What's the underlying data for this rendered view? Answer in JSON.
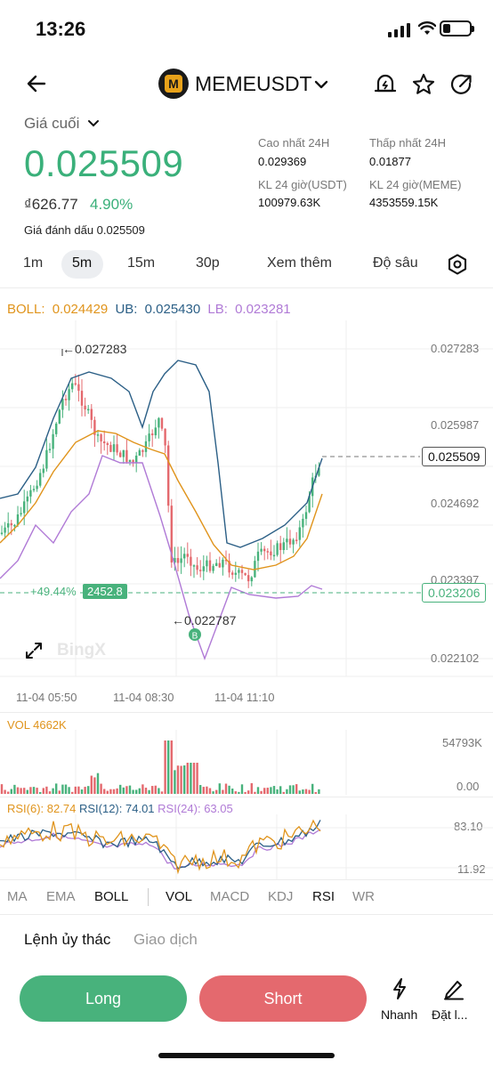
{
  "status_bar": {
    "time": "13:26"
  },
  "header": {
    "pair": "MEMEUSDT",
    "logo_letter": "M"
  },
  "price": {
    "label": "Giá cuối",
    "last": "0.025509",
    "fiat": "₫626.77",
    "change_pct": "4.90%",
    "mark": "Giá đánh dấu 0.025509"
  },
  "stats": {
    "high_label": "Cao nhất 24H",
    "high": "0.029369",
    "low_label": "Thấp nhất 24H",
    "low": "0.01877",
    "vol_usdt_label": "KL 24 giờ(USDT)",
    "vol_usdt": "100979.63K",
    "vol_meme_label": "KL 24 giờ(MEME)",
    "vol_meme": "4353559.15K"
  },
  "timeframes": {
    "t1": "1m",
    "t2": "5m",
    "t3": "15m",
    "t4": "30p",
    "more": "Xem thêm",
    "depth": "Độ sâu",
    "active": "5m"
  },
  "boll": {
    "label": "BOLL:",
    "mid": "0.024429",
    "ub_label": "UB:",
    "ub": "0.025430",
    "lb_label": "LB:",
    "lb": "0.023281"
  },
  "price_axis": {
    "p1": "0.027283",
    "p2": "0.025987",
    "p3": "0.024692",
    "p4": "0.023397",
    "p5": "0.022102"
  },
  "chart_tags": {
    "high_marker": "←0.027283",
    "low_marker": "←0.022787",
    "current": "0.025509",
    "position_pct": "+49.44%",
    "position_qty": "2452.8",
    "position_price": "0.023206",
    "buy_marker": "B",
    "watermark": "BingX"
  },
  "time_axis": {
    "t1": "11-04 05:50",
    "t2": "11-04 08:30",
    "t3": "11-04 11:10"
  },
  "volume": {
    "legend": "VOL 4662K",
    "max": "54793K",
    "min": "0.00"
  },
  "rsi": {
    "l6": "RSI(6):",
    "v6": "82.74",
    "l12": "RSI(12):",
    "v12": "74.01",
    "l24": "RSI(24):",
    "v24": "63.05",
    "top": "83.10",
    "bottom": "11.92"
  },
  "indicators": {
    "ma": "MA",
    "ema": "EMA",
    "boll": "BOLL",
    "vol": "VOL",
    "macd": "MACD",
    "kdj": "KDJ",
    "rsi": "RSI",
    "wr": "WR"
  },
  "trade_tabs": {
    "order": "Lệnh ủy thác",
    "trade": "Giao dịch"
  },
  "actions": {
    "long": "Long",
    "short": "Short",
    "quick": "Nhanh",
    "place": "Đặt l..."
  },
  "colors": {
    "up": "#48b27c",
    "down": "#e4696e",
    "boll_mid": "#e0941c",
    "boll_ub": "#2b5f86",
    "boll_lb": "#b07ad6",
    "rsi6": "#e0941c",
    "rsi12": "#2b5f86",
    "rsi24": "#b07ad6"
  },
  "icons": [
    "back-arrow-icon",
    "bell-icon",
    "star-icon",
    "share-icon",
    "chevron-down-icon",
    "settings-icon",
    "expand-icon",
    "lightning-icon",
    "pencil-icon"
  ]
}
